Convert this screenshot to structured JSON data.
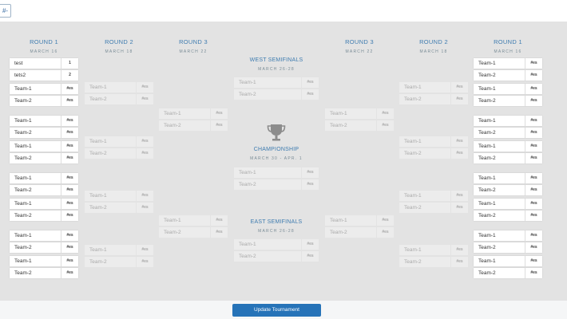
{
  "topbar": {
    "menu_glyph": "#-"
  },
  "headers": {
    "round1_left": {
      "title": "ROUND 1",
      "dates": "MARCH 16"
    },
    "round2_left": {
      "title": "ROUND 2",
      "dates": "MARCH 18"
    },
    "round3_left": {
      "title": "ROUND 3",
      "dates": "MARCH 22"
    },
    "round3_right": {
      "title": "ROUND 3",
      "dates": "MARCH 22"
    },
    "round2_right": {
      "title": "ROUND 2",
      "dates": "MARCH 18"
    },
    "round1_right": {
      "title": "ROUND 1",
      "dates": "MARCH 16"
    }
  },
  "center": {
    "west": {
      "title": "WEST SEMIFINALS",
      "dates": "MARCH 26-28"
    },
    "championship": {
      "title": "CHAMPIONSHIP",
      "dates": "MARCH 30 - APR. 1"
    },
    "east": {
      "title": "EAST SEMIFINALS",
      "dates": "MARCH 26-28"
    },
    "trophy_icon": "trophy-icon"
  },
  "left_round1": [
    {
      "name": "test",
      "score": "1"
    },
    {
      "name": "tets2",
      "score": "2"
    },
    {
      "name": "Team-1",
      "score": "#es"
    },
    {
      "name": "Team-2",
      "score": "#es"
    },
    {
      "name": "Team-1",
      "score": "#es"
    },
    {
      "name": "Team-2",
      "score": "#es"
    },
    {
      "name": "Team-1",
      "score": "#es"
    },
    {
      "name": "Team-2",
      "score": "#es"
    },
    {
      "name": "Team-1",
      "score": "#es"
    },
    {
      "name": "Team-2",
      "score": "#es"
    },
    {
      "name": "Team-1",
      "score": "#es"
    },
    {
      "name": "Team-2",
      "score": "#es"
    },
    {
      "name": "Team-1",
      "score": "#es"
    },
    {
      "name": "Team-2",
      "score": "#es"
    },
    {
      "name": "Team-1",
      "score": "#es"
    },
    {
      "name": "Team-2",
      "score": "#es"
    }
  ],
  "left_round2": [
    {
      "name": "Team-1",
      "score": "#es"
    },
    {
      "name": "Team-2",
      "score": "#es"
    },
    {
      "name": "Team-1",
      "score": "#es"
    },
    {
      "name": "Team-2",
      "score": "#es"
    },
    {
      "name": "Team-1",
      "score": "#es"
    },
    {
      "name": "Team-2",
      "score": "#es"
    },
    {
      "name": "Team-1",
      "score": "#es"
    },
    {
      "name": "Team-2",
      "score": "#es"
    }
  ],
  "left_round3": [
    {
      "name": "Team-1",
      "score": "#es"
    },
    {
      "name": "Team-2",
      "score": "#es"
    },
    {
      "name": "Team-1",
      "score": "#es"
    },
    {
      "name": "Team-2",
      "score": "#es"
    }
  ],
  "west_semis": [
    {
      "name": "Team-1",
      "score": "#es"
    },
    {
      "name": "Team-2",
      "score": "#es"
    }
  ],
  "championship_match": [
    {
      "name": "Team-1",
      "score": "#es"
    },
    {
      "name": "Team-2",
      "score": "#es"
    }
  ],
  "east_semis": [
    {
      "name": "Team-1",
      "score": "#es"
    },
    {
      "name": "Team-2",
      "score": "#es"
    }
  ],
  "right_round3": [
    {
      "name": "Team-1",
      "score": "#es"
    },
    {
      "name": "Team-2",
      "score": "#es"
    },
    {
      "name": "Team-1",
      "score": "#es"
    },
    {
      "name": "Team-2",
      "score": "#es"
    }
  ],
  "right_round2": [
    {
      "name": "Team-1",
      "score": "#es"
    },
    {
      "name": "Team-2",
      "score": "#es"
    },
    {
      "name": "Team-1",
      "score": "#es"
    },
    {
      "name": "Team-2",
      "score": "#es"
    },
    {
      "name": "Team-1",
      "score": "#es"
    },
    {
      "name": "Team-2",
      "score": "#es"
    },
    {
      "name": "Team-1",
      "score": "#es"
    },
    {
      "name": "Team-2",
      "score": "#es"
    }
  ],
  "right_round1": [
    {
      "name": "Team-1",
      "score": "#es"
    },
    {
      "name": "Team-2",
      "score": "#es"
    },
    {
      "name": "Team-1",
      "score": "#es"
    },
    {
      "name": "Team-2",
      "score": "#es"
    },
    {
      "name": "Team-1",
      "score": "#es"
    },
    {
      "name": "Team-2",
      "score": "#es"
    },
    {
      "name": "Team-1",
      "score": "#es"
    },
    {
      "name": "Team-2",
      "score": "#es"
    },
    {
      "name": "Team-1",
      "score": "#es"
    },
    {
      "name": "Team-2",
      "score": "#es"
    },
    {
      "name": "Team-1",
      "score": "#es"
    },
    {
      "name": "Team-2",
      "score": "#es"
    },
    {
      "name": "Team-1",
      "score": "#es"
    },
    {
      "name": "Team-2",
      "score": "#es"
    },
    {
      "name": "Team-1",
      "score": "#es"
    },
    {
      "name": "Team-2",
      "score": "#es"
    }
  ],
  "footer": {
    "update_label": "Update Tournament"
  },
  "colors": {
    "accent": "#3f7cb0",
    "button": "#2673b8",
    "background": "#e3e3e3"
  }
}
